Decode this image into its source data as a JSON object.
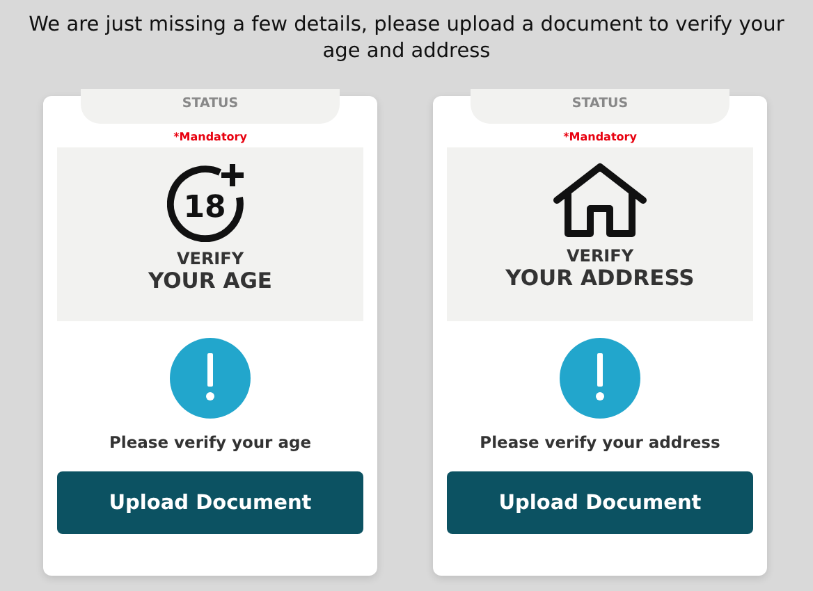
{
  "intro": "We are just missing a few details, please upload a document to verify your age and address",
  "cards": [
    {
      "kind": "age",
      "badge": "18",
      "status": "STATUS",
      "mandatory": "*Mandatory",
      "verify": "VERIFY",
      "title": "YOUR AGE",
      "message": "Please verify your age",
      "button": "Upload Document"
    },
    {
      "kind": "address",
      "status": "STATUS",
      "mandatory": "*Mandatory",
      "verify": "VERIFY",
      "title": "YOUR ADDRESS",
      "message": "Please verify your address",
      "button": "Upload Document"
    }
  ]
}
